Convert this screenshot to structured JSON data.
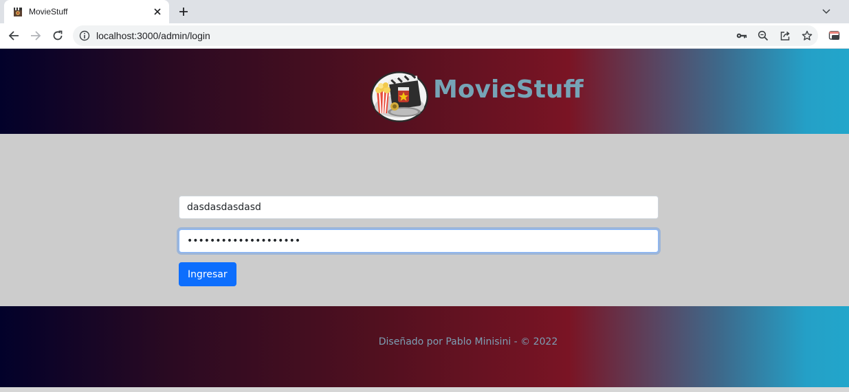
{
  "browser": {
    "tab_title": "MovieStuff",
    "url": "localhost:3000/admin/login",
    "icons": {
      "favicon": "movie-clapper-icon",
      "close": "close-icon",
      "new_tab": "plus-icon",
      "tab_search": "chevron-down-icon",
      "back": "back-arrow-icon",
      "forward": "forward-arrow-icon",
      "reload": "reload-icon",
      "site_info": "info-icon",
      "password_key": "key-icon",
      "zoom": "zoom-icon",
      "share": "share-icon",
      "bookmark": "star-icon",
      "extension": "window-icon"
    }
  },
  "header": {
    "brand": "MovieStuff",
    "logo": "movie-popcorn-logo"
  },
  "login": {
    "username_value": "dasdasdasdasd",
    "password_value": "••••••••••••••••••••",
    "submit_label": "Ingresar"
  },
  "footer": {
    "text": "Diseñado por Pablo Minisini - © 2022"
  },
  "colors": {
    "gradient_start": "#02012a",
    "gradient_mid": "#7a1424",
    "gradient_end": "#22a6cb",
    "brand_text": "#76a4b6",
    "primary_button": "#0d6efd",
    "main_background": "#cccccc"
  }
}
